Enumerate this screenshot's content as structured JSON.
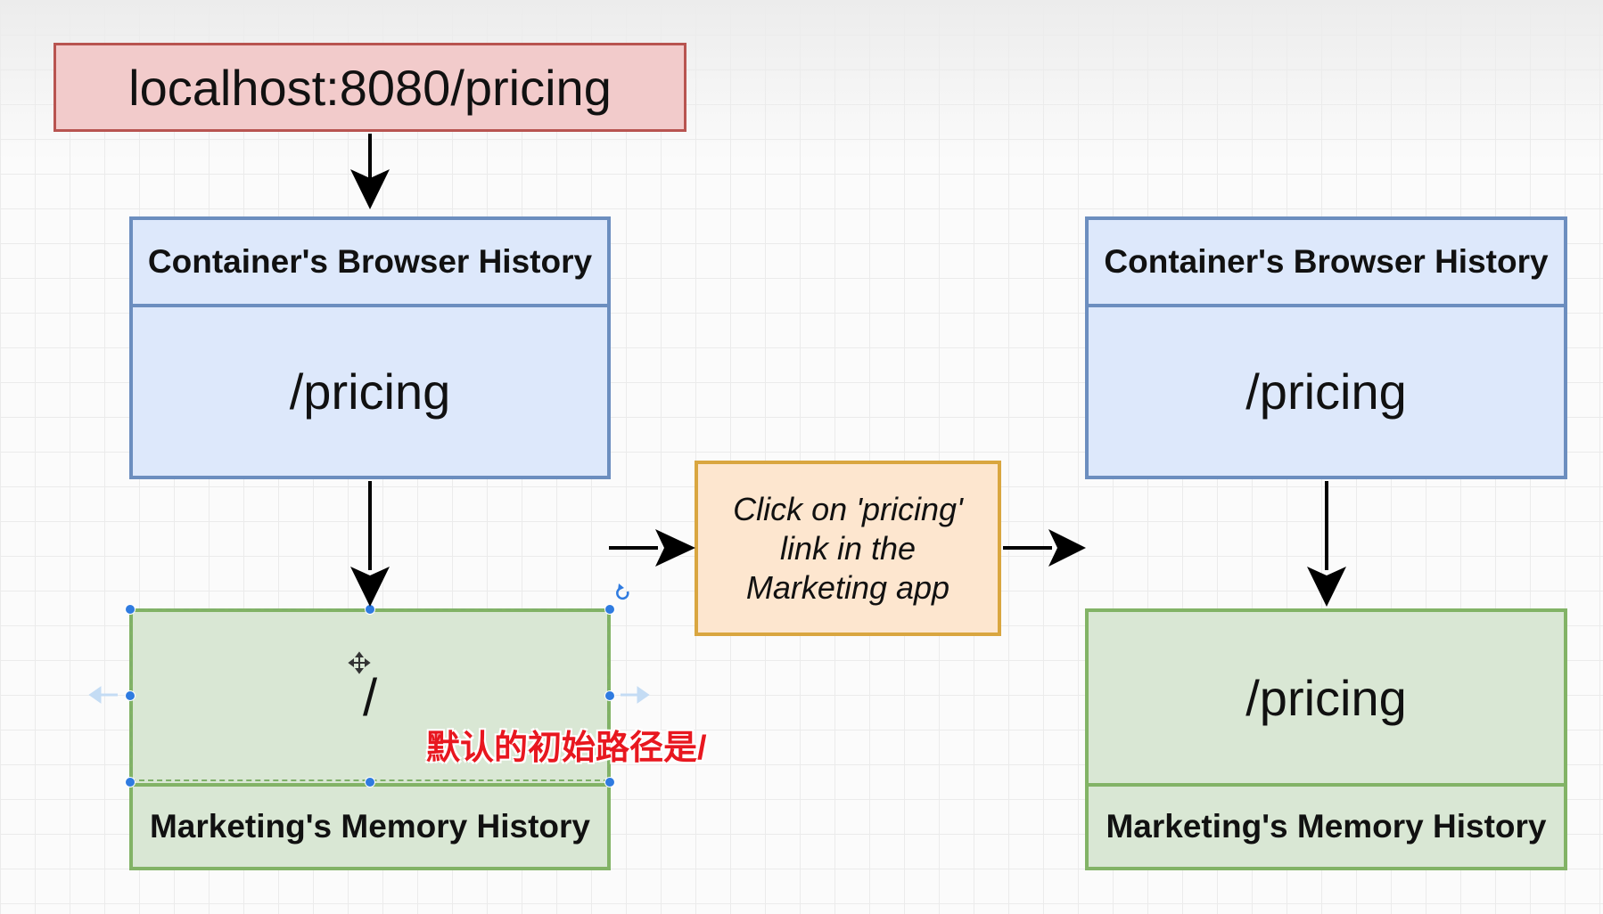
{
  "url_box": {
    "text": "localhost:8080/pricing"
  },
  "left": {
    "container_header": "Container's Browser History",
    "container_path": "/pricing",
    "marketing_path": "/",
    "marketing_footer": "Marketing's Memory History"
  },
  "action": {
    "line1": "Click on 'pricing'",
    "line2": "link in the",
    "line3": "Marketing app"
  },
  "right": {
    "container_header": "Container's Browser History",
    "container_path": "/pricing",
    "marketing_path": "/pricing",
    "marketing_footer": "Marketing's Memory History"
  },
  "subtitle": "默认的初始路径是/",
  "icons": {
    "move": "move-cursor-icon",
    "rotate": "rotate-icon",
    "arrow_left": "arrow-left-icon",
    "arrow_right": "arrow-right-icon"
  },
  "colors": {
    "url_fill": "#f2cbcb",
    "url_stroke": "#b85450",
    "blue_fill": "#dde8fb",
    "blue_stroke": "#6c8ebf",
    "green_fill": "#d9e7d4",
    "green_stroke": "#82b366",
    "orange_fill": "#fde6cf",
    "orange_stroke": "#d9a640",
    "subtitle": "#e8171f",
    "selection": "#2f7be0"
  }
}
